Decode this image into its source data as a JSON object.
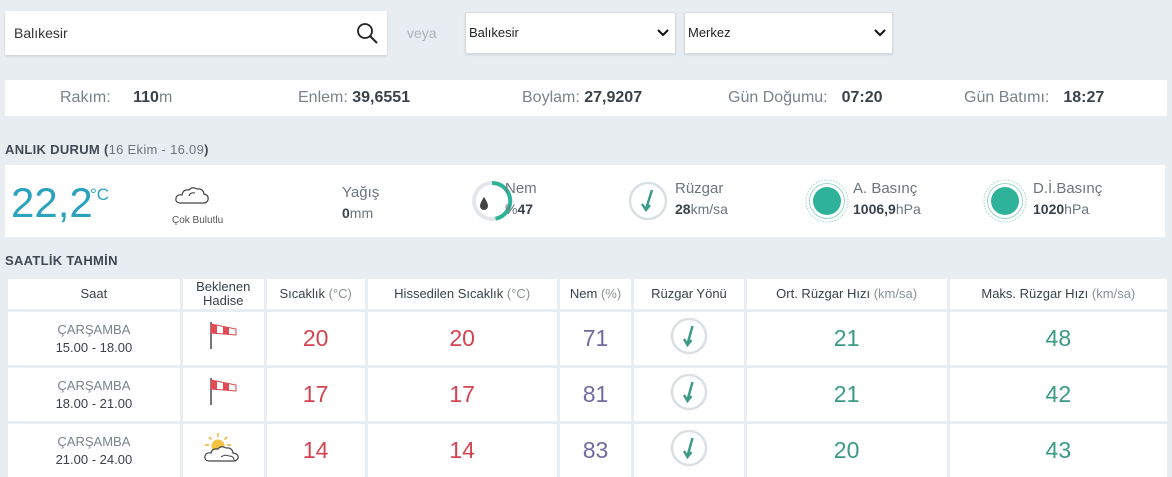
{
  "search": {
    "value": "Balıkesir"
  },
  "veya": "veya",
  "selects": {
    "il": "Balıkesir",
    "ilce": "Merkez"
  },
  "info": {
    "rakim_label": "Rakım:",
    "rakim_value": "110",
    "rakim_unit": "m",
    "enlem_label": "Enlem:",
    "enlem_value": "39,6551",
    "boylam_label": "Boylam:",
    "boylam_value": "27,9207",
    "gun_dogumu_label": "Gün Doğumu:",
    "gun_dogumu_value": "07:20",
    "gun_batimi_label": "Gün Batımı:",
    "gun_batimi_value": "18:27"
  },
  "current": {
    "title": "ANLIK DURUM",
    "time_open": "(",
    "time": "16 Ekim - 16.09",
    "time_close": ")",
    "temperature": "22,2",
    "temperature_unit": "°C",
    "condition": "Çok Bulutlu",
    "condition_icon": "cloud-icon",
    "yagis_label": "Yağış",
    "yagis_value": "0",
    "yagis_unit": "mm",
    "nem_label": "Nem",
    "nem_prefix": "%",
    "nem_value": "47",
    "ruzgar_label": "Rüzgar",
    "ruzgar_value": "28",
    "ruzgar_unit": "km/sa",
    "a_basinc_label": "A. Basınç",
    "a_basinc_value": "1006,9",
    "a_basinc_unit": "hPa",
    "di_basinc_label": "D.İ.Basınç",
    "di_basinc_value": "1020",
    "di_basinc_unit": "hPa"
  },
  "hourly": {
    "title": "SAATLİK TAHMİN",
    "headers": {
      "saat": "Saat",
      "beklenen_1": "Beklenen",
      "beklenen_2": "Hadise",
      "sicaklik": "Sıcaklık",
      "sicaklik_unit": "(°C)",
      "hissedilen": "Hissedilen Sıcaklık",
      "hissedilen_unit": "(°C)",
      "nem": "Nem",
      "nem_unit": "(%)",
      "ruzgar_yonu": "Rüzgar Yönü",
      "ort": "Ort. Rüzgar Hızı",
      "ort_unit": "(km/sa)",
      "maks": "Maks. Rüzgar Hızı",
      "maks_unit": "(km/sa)"
    },
    "rows": [
      {
        "day": "ÇARŞAMBA",
        "time": "15.00 - 18.00",
        "icon": "windsock-icon",
        "sicaklik": "20",
        "hissedilen": "20",
        "nem": "71",
        "ort": "21",
        "maks": "48"
      },
      {
        "day": "ÇARŞAMBA",
        "time": "18.00 - 21.00",
        "icon": "windsock-icon",
        "sicaklik": "17",
        "hissedilen": "17",
        "nem": "81",
        "ort": "21",
        "maks": "42"
      },
      {
        "day": "ÇARŞAMBA",
        "time": "21.00 - 24.00",
        "icon": "partly-cloudy-icon",
        "sicaklik": "14",
        "hissedilen": "14",
        "nem": "83",
        "ort": "20",
        "maks": "43"
      }
    ]
  },
  "colors": {
    "accent": "#2ba3bf",
    "temp": "#d4434f",
    "humidity": "#6f6b9e",
    "wind": "#3a9a86",
    "pressure": "#2eb39a"
  }
}
